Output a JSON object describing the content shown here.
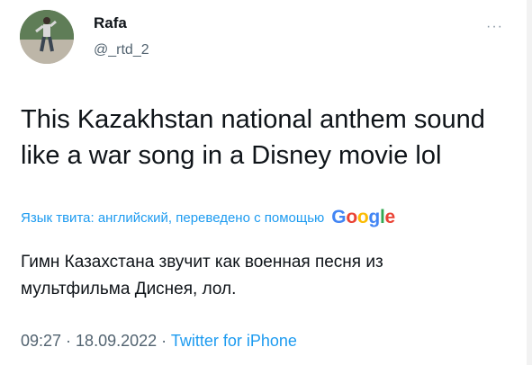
{
  "author": {
    "name": "Rafa",
    "handle": "@_rtd_2"
  },
  "more_label": "···",
  "tweet": {
    "text": "This Kazakhstan national anthem sound\nlike a war song in a Disney movie lol"
  },
  "translation": {
    "label": "Язык твита: английский, переведено с помощью",
    "provider_logo": [
      "G",
      "o",
      "o",
      "g",
      "l",
      "e"
    ],
    "provider_colors": [
      "#4285F4",
      "#EA4335",
      "#FBBC05",
      "#4285F4",
      "#34A853",
      "#EA4335"
    ],
    "text": "Гимн Казахстана звучит как военная песня из\nмультфильма Диснея, лол."
  },
  "meta": {
    "time": "09:27",
    "separator": " · ",
    "date": "18.09.2022",
    "source": "Twitter for iPhone"
  },
  "colors": {
    "link": "#1d9bf0",
    "secondary": "#536471",
    "primary": "#0f1419"
  }
}
